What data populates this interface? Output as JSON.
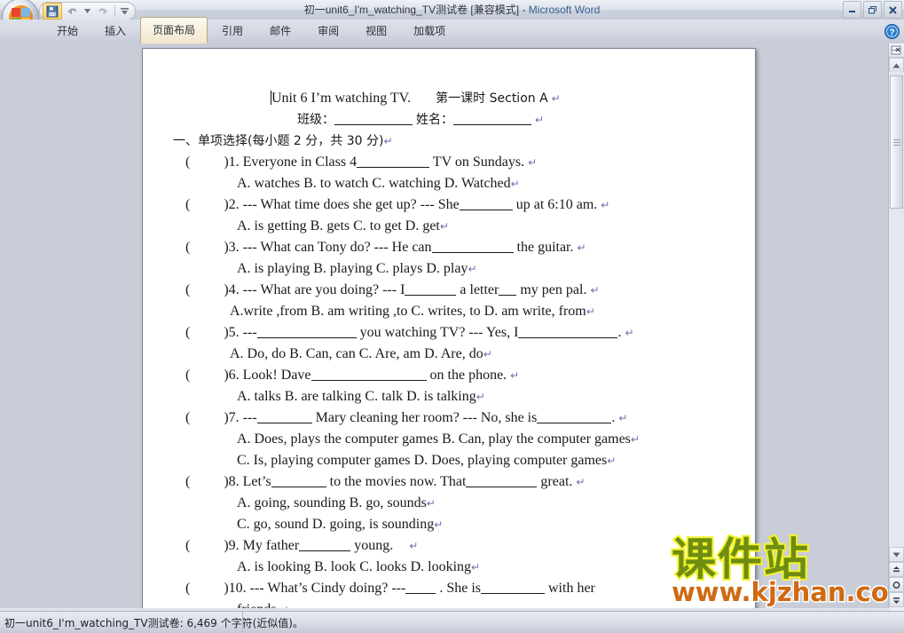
{
  "window": {
    "title_doc": "初一unit6_I'm_watching_TV测试卷 [兼容模式]",
    "title_sep": " - ",
    "title_app": "Microsoft Word",
    "minimize": "minimize-icon",
    "restore": "restore-icon",
    "close": "close-icon"
  },
  "quick_access": {
    "office_button": "office-orb",
    "save": "save-icon",
    "undo": "undo-icon",
    "undo_dropdown": "chevron-down-icon",
    "redo": "redo-icon",
    "customize": "customize-qat-icon"
  },
  "ribbon": {
    "tabs": [
      {
        "label": "开始",
        "active": false
      },
      {
        "label": "插入",
        "active": false
      },
      {
        "label": "页面布局",
        "active": true
      },
      {
        "label": "引用",
        "active": false
      },
      {
        "label": "邮件",
        "active": false
      },
      {
        "label": "审阅",
        "active": false
      },
      {
        "label": "视图",
        "active": false
      },
      {
        "label": "加载项",
        "active": false
      }
    ],
    "help": "help-icon"
  },
  "document": {
    "heading": {
      "title_en": "Unit 6 I’m watching TV.",
      "title_cn": "第一课时 Section A",
      "fields": {
        "class_label": "班级：",
        "name_label": "姓名："
      }
    },
    "section_heading": "一、单项选择(每小题 2 分，共 30 分)",
    "questions": [
      {
        "num": "1.",
        "stem_before": "Everyone in Class 4",
        "stem_after": "TV on Sundays.",
        "options": "A. watches   B. to watch   C. watching   D. Watched"
      },
      {
        "num": "2.",
        "stem_before": "--- What time does she get up?    --- She",
        "stem_after": "up at 6:10 am.",
        "options": "A. is getting     B. gets    C. to get      D. get"
      },
      {
        "num": "3.",
        "stem_before": "--- What can Tony do?        --- He can",
        "stem_after": "the guitar.",
        "options": "A. is playing    B. playing    C. plays     D. play"
      },
      {
        "num": "4.",
        "stem_before": "--- What are you doing?          --- I",
        "stem_mid": "a letter",
        "stem_after": "my pen pal.",
        "options": "A.write ,from    B. am writing ,to    C. writes, to   D. am write, from"
      },
      {
        "num": "5.",
        "stem_before": "---",
        "stem_mid": "you watching TV?    --- Yes, I",
        "stem_after": ".",
        "options": "A. Do, do    B. Can, can    C. Are, am    D. Are, do"
      },
      {
        "num": "6.",
        "stem_before": "Look! Dave",
        "stem_after": "on the phone.",
        "options": "A. talks   B. are talking   C. talk     D. is talking"
      },
      {
        "num": "7.",
        "stem_before": "---",
        "stem_mid": "Mary cleaning her room?  --- No, she is",
        "stem_after": ".",
        "options_a": "A. Does, plays the computer games   B. Can, play the computer games",
        "options_b": "C. Is, playing    computer games     D. Does, playing computer games"
      },
      {
        "num": "8.",
        "stem_before": "Let’s",
        "stem_mid": "to the movies now.    That",
        "stem_after": "great.",
        "options_a": "A. going, sounding            B. go, sounds",
        "options_b": "C. go, sound                D. going, is sounding"
      },
      {
        "num": "9.",
        "stem_before": "My father",
        "stem_after": "young.",
        "options": "A. is looking     B. look      C. looks      D. looking"
      },
      {
        "num": "10.",
        "stem_before": "---  What’s  Cindy  doing?   ---",
        "stem_mid": ".  She  is",
        "stem_after": "with her",
        "continuation": "friends."
      }
    ],
    "paren_open": "(",
    "paren_close": ")",
    "pilcrow": "↵"
  },
  "watermark": {
    "brand_cn": "课件站",
    "brand_url": "www.kjzhan.com",
    "brand_color": "#6f8d11",
    "outline_color": "#f2f22a",
    "url_color": "#cf6a12"
  },
  "scrollbar": {
    "split_view": "split-view-icon",
    "scroll_up": "chevron-up-icon",
    "scroll_down": "chevron-down-icon",
    "previous_page": "previous-page-icon",
    "select_browse_object": "select-browse-object-icon",
    "next_page": "next-page-icon"
  },
  "statusbar": {
    "text": "初一unit6_I'm_watching_TV测试卷: 6,469 个字符(近似值)。"
  }
}
